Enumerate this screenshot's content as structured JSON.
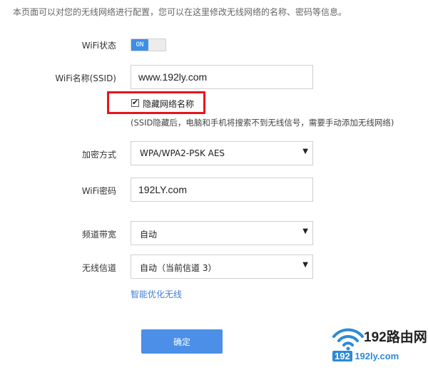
{
  "intro": "本页面可以对您的无线网络进行配置，您可以在这里修改无线网络的名称、密码等信息。",
  "wifi_status": {
    "label": "WiFi状态",
    "toggle_text": "ON"
  },
  "ssid": {
    "label": "WiFi名称(SSID)",
    "value": "www.192ly.com"
  },
  "hide_ssid": {
    "label": "隐藏网络名称",
    "checked": true,
    "hint": "(SSID隐藏后，电脑和手机将搜索不到无线信号，需要手动添加无线网络)"
  },
  "encryption": {
    "label": "加密方式",
    "value": "WPA/WPA2-PSK AES"
  },
  "password": {
    "label": "WiFi密码",
    "value": "192LY.com"
  },
  "bandwidth": {
    "label": "频道带宽",
    "value": "自动"
  },
  "channel": {
    "label": "无线信道",
    "value": "自动（当前信道 3）"
  },
  "optimize_link": "智能优化无线",
  "confirm_button": "确定",
  "watermark": {
    "title": "192路由网",
    "sub_left": "192",
    "sub_right": "192ly.com"
  },
  "colors": {
    "accent": "#4b8fe8",
    "highlight": "#e8141c",
    "link": "#3d7fd6"
  }
}
